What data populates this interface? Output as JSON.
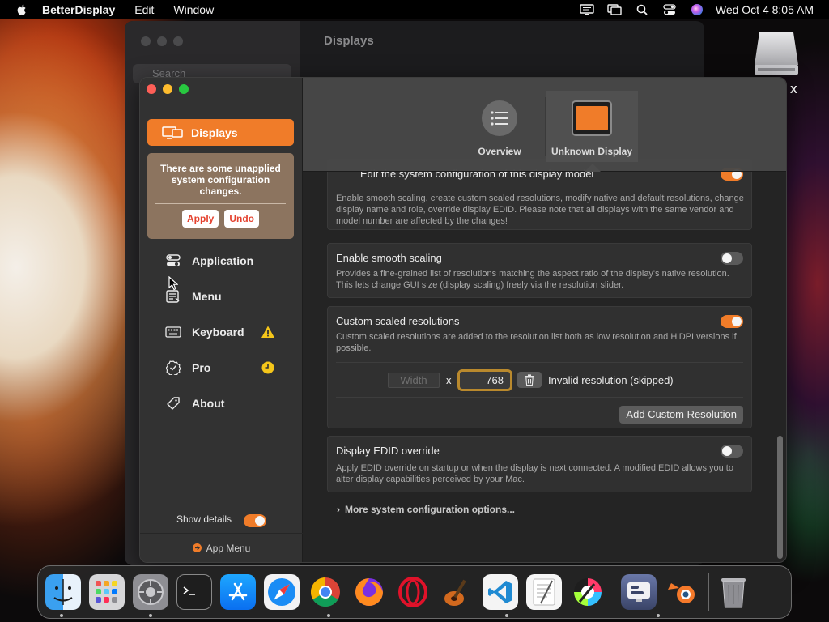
{
  "menubar": {
    "app_name": "BetterDisplay",
    "items": [
      "Edit",
      "Window"
    ],
    "clock": "Wed Oct 4  8:05 AM"
  },
  "back_window": {
    "search_placeholder": "Search",
    "title": "Displays"
  },
  "desktop": {
    "disk_label": "X"
  },
  "sidebar": {
    "active_item": "Displays",
    "unapplied_message": "There are some unapplied system configuration changes.",
    "apply_label": "Apply",
    "undo_label": "Undo",
    "items": [
      {
        "label": "Application",
        "icon": "toggles-icon"
      },
      {
        "label": "Menu",
        "icon": "menu-list-icon"
      },
      {
        "label": "Keyboard",
        "icon": "keyboard-icon",
        "badge": "warning-icon"
      },
      {
        "label": "Pro",
        "icon": "seal-check-icon",
        "badge": "clock-icon"
      },
      {
        "label": "About",
        "icon": "tag-icon"
      }
    ],
    "show_details_label": "Show details",
    "show_details_on": true,
    "footer_label": "App Menu"
  },
  "toolbar": {
    "overview_label": "Overview",
    "display_label": "Unknown Display"
  },
  "content": {
    "edit_config": {
      "title": "Edit the system configuration of this display model",
      "desc": "Enable smooth scaling, create custom scaled resolutions, modify native and default resolutions, change display name and role, override display EDID. Please note that all displays with the same vendor and model number are affected by the changes!",
      "enabled": true
    },
    "smooth_scaling": {
      "title": "Enable smooth scaling",
      "desc": "Provides a fine-grained list of resolutions matching the aspect ratio of the display's native resolution. This lets change GUI size (display scaling) freely via the resolution slider.",
      "enabled": false
    },
    "custom_res": {
      "title": "Custom scaled resolutions",
      "desc": "Custom scaled resolutions are added to the resolution list both as low resolution and HiDPI versions if possible.",
      "enabled": true,
      "width_placeholder": "Width",
      "x_label": "x",
      "height_value": "768",
      "status": "Invalid resolution (skipped)",
      "add_button": "Add Custom Resolution"
    },
    "edid_override": {
      "title": "Display EDID override",
      "desc": "Apply EDID override on startup or when the display is next connected. A modified EDID allows you to alter display capabilities perceived by your Mac.",
      "enabled": false
    },
    "more_options": "More system configuration options..."
  },
  "dock": {
    "apps": [
      "Finder",
      "Launchpad",
      "System Settings",
      "Terminal",
      "App Store",
      "Safari",
      "Chrome",
      "Firefox",
      "Opera",
      "GarageBand",
      "Visual Studio Code",
      "TextEdit",
      "Pixelmator",
      "BetterDisplay",
      "Blender",
      "Trash"
    ]
  },
  "colors": {
    "accent": "#f07c29",
    "window_bg": "#242424",
    "sidebar_bg": "#323232",
    "warning": "#f5c61a"
  }
}
